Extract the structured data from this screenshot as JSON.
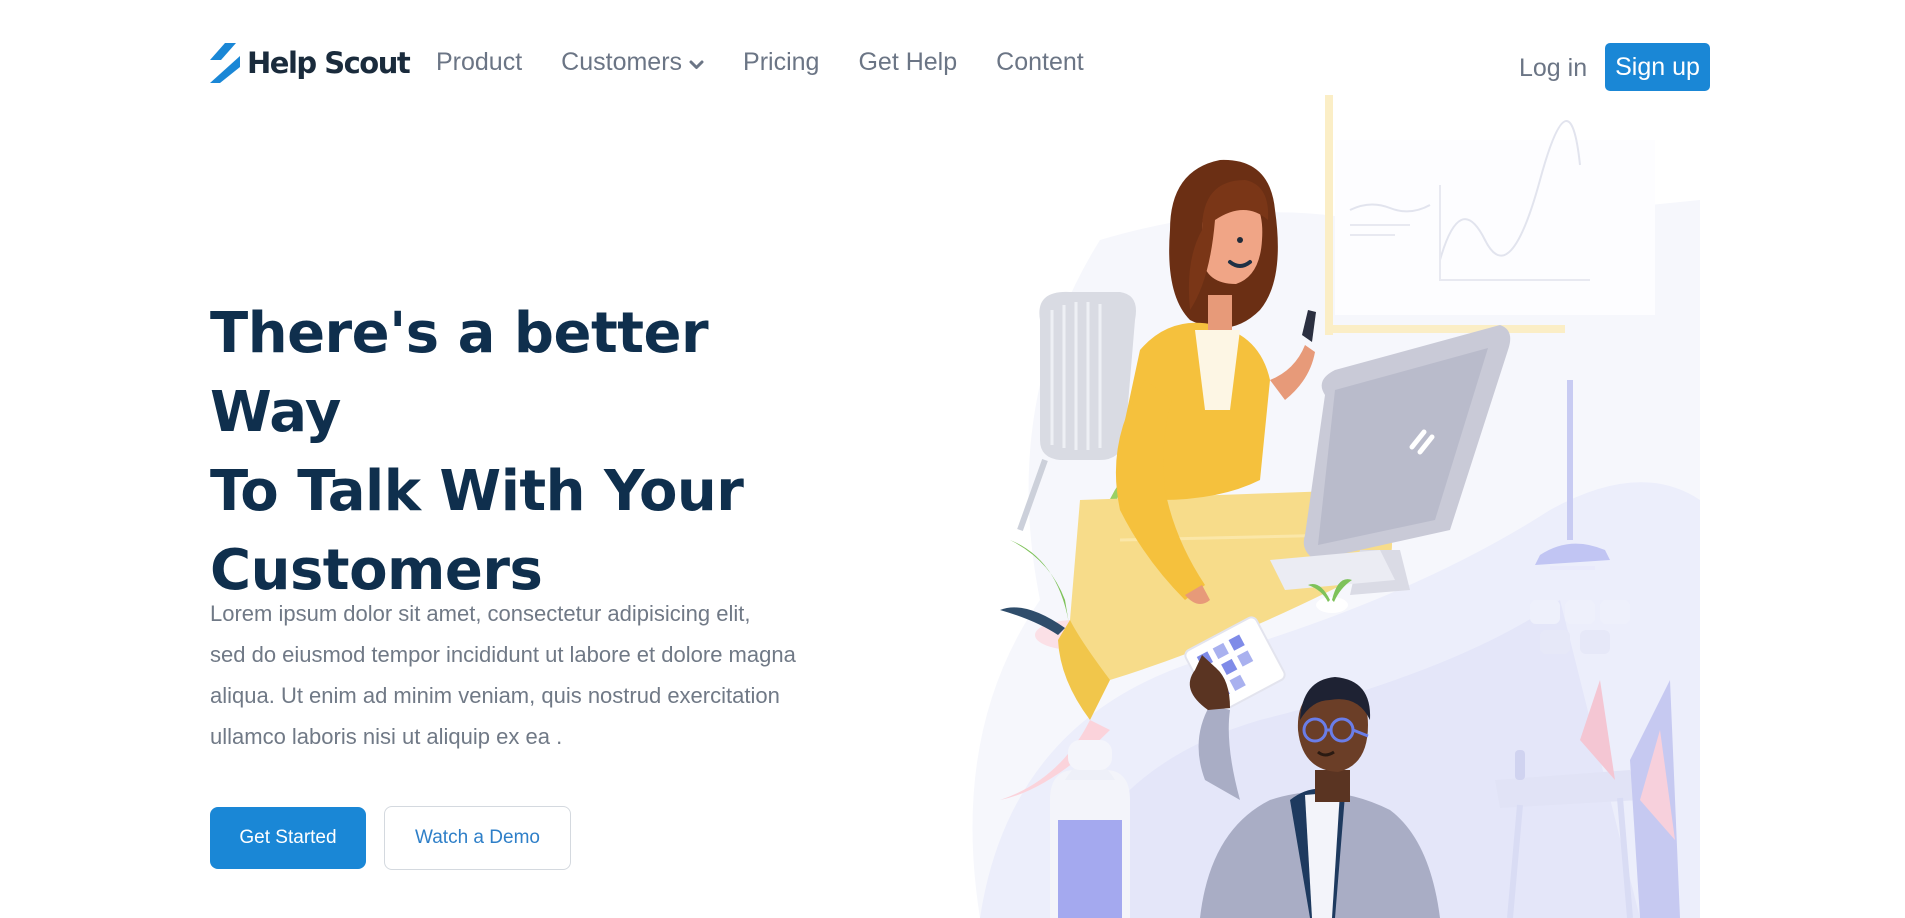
{
  "nav": {
    "logo_text": "Help Scout",
    "items": [
      {
        "label": "Product"
      },
      {
        "label": "Customers"
      },
      {
        "label": "Pricing"
      },
      {
        "label": "Get Help"
      },
      {
        "label": "Content"
      }
    ],
    "login_label": "Log in",
    "signup_label": "Sign up"
  },
  "hero": {
    "title_lines": [
      "There's a better Way",
      "To Talk With Your",
      "Customers"
    ],
    "description_lines": [
      "Lorem ipsum dolor sit amet, consectetur adipisicing elit,",
      "sed do eiusmod tempor incididunt ut labore et dolore magna",
      "aliqua. Ut enim ad minim veniam, quis nostrud exercitation",
      "ullamco laboris nisi ut aliquip ex ea ."
    ],
    "primary_button": "Get Started",
    "secondary_button": "Watch a Demo"
  },
  "icons": {
    "logo": "help-scout-logo-icon",
    "dropdown": "chevron-down-icon"
  },
  "colors": {
    "brand_blue": "#1a87d6",
    "heading": "#0f2f4d",
    "nav_text": "#6b7585",
    "body_text": "#707986",
    "secondary_button_text": "#2e7fc8"
  }
}
